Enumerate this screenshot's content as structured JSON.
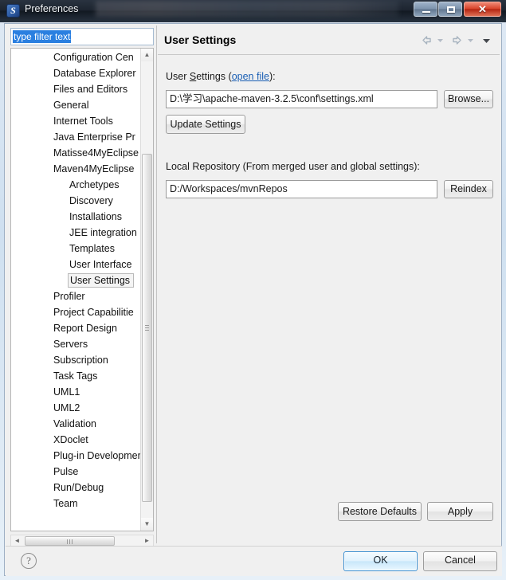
{
  "window": {
    "title": "Preferences",
    "icon": "eclipse-app-icon",
    "controls": {
      "minimize": "minimize-button",
      "maximize": "maximize-button",
      "close_glyph": "✕"
    }
  },
  "filter": {
    "value": "type filter text",
    "placeholder": "type filter text"
  },
  "tree": {
    "items": [
      {
        "label": "Configuration Cen",
        "level": 1,
        "selected": false
      },
      {
        "label": "Database Explorer",
        "level": 1,
        "selected": false
      },
      {
        "label": "Files and Editors",
        "level": 1,
        "selected": false
      },
      {
        "label": "General",
        "level": 1,
        "selected": false
      },
      {
        "label": "Internet Tools",
        "level": 1,
        "selected": false
      },
      {
        "label": "Java Enterprise Pr",
        "level": 1,
        "selected": false
      },
      {
        "label": "Matisse4MyEclipse",
        "level": 1,
        "selected": false
      },
      {
        "label": "Maven4MyEclipse",
        "level": 1,
        "selected": false
      },
      {
        "label": "Archetypes",
        "level": 2,
        "selected": false
      },
      {
        "label": "Discovery",
        "level": 2,
        "selected": false
      },
      {
        "label": "Installations",
        "level": 2,
        "selected": false
      },
      {
        "label": "JEE integration",
        "level": 2,
        "selected": false
      },
      {
        "label": "Templates",
        "level": 2,
        "selected": false
      },
      {
        "label": "User Interface",
        "level": 2,
        "selected": false
      },
      {
        "label": "User Settings",
        "level": 2,
        "selected": true
      },
      {
        "label": "Profiler",
        "level": 1,
        "selected": false
      },
      {
        "label": "Project Capabilitie",
        "level": 1,
        "selected": false
      },
      {
        "label": "Report Design",
        "level": 1,
        "selected": false
      },
      {
        "label": "Servers",
        "level": 1,
        "selected": false
      },
      {
        "label": "Subscription",
        "level": 1,
        "selected": false
      },
      {
        "label": "Task Tags",
        "level": 1,
        "selected": false
      },
      {
        "label": "UML1",
        "level": 1,
        "selected": false
      },
      {
        "label": "UML2",
        "level": 1,
        "selected": false
      },
      {
        "label": "Validation",
        "level": 1,
        "selected": false
      },
      {
        "label": "XDoclet",
        "level": 1,
        "selected": false
      },
      {
        "label": "Plug-in Development",
        "level": 1,
        "selected": false
      },
      {
        "label": "Pulse",
        "level": 1,
        "selected": false
      },
      {
        "label": "Run/Debug",
        "level": 1,
        "selected": false
      },
      {
        "label": "Team",
        "level": 1,
        "selected": false
      }
    ],
    "scroll_up_glyph": "▲",
    "scroll_down_glyph": "▼",
    "scroll_left_glyph": "◄",
    "scroll_right_glyph": "►"
  },
  "page": {
    "title": "User Settings",
    "nav": {
      "back": "back-arrow-icon",
      "back_menu": "back-dropdown-icon",
      "forward": "forward-arrow-icon",
      "forward_menu": "forward-dropdown-icon",
      "view_menu": "view-menu-icon"
    },
    "user_settings": {
      "label_prefix": "User ",
      "label_mnemonic": "S",
      "label_rest": "ettings (",
      "link": "open file",
      "label_suffix": "):",
      "value": "D:\\学习\\apache-maven-3.2.5\\conf\\settings.xml",
      "browse_label": "Browse...",
      "update_label": "Update Settings"
    },
    "local_repository": {
      "label": "Local Repository (From merged user and global settings):",
      "value": "D:/Workspaces/mvnRepos",
      "reindex_label": "Reindex"
    },
    "restore_defaults_label": "Restore Defaults",
    "apply_label": "Apply"
  },
  "footer": {
    "help_glyph": "?",
    "ok_label": "OK",
    "cancel_label": "Cancel"
  },
  "colors": {
    "titlebar": "#1d2530",
    "close_button": "#d9452c",
    "selection": "#2a7fe0",
    "link": "#1a5fb4",
    "ok_focus_border": "#3c8fd0",
    "dialog_bg": "#f0f0f0"
  }
}
